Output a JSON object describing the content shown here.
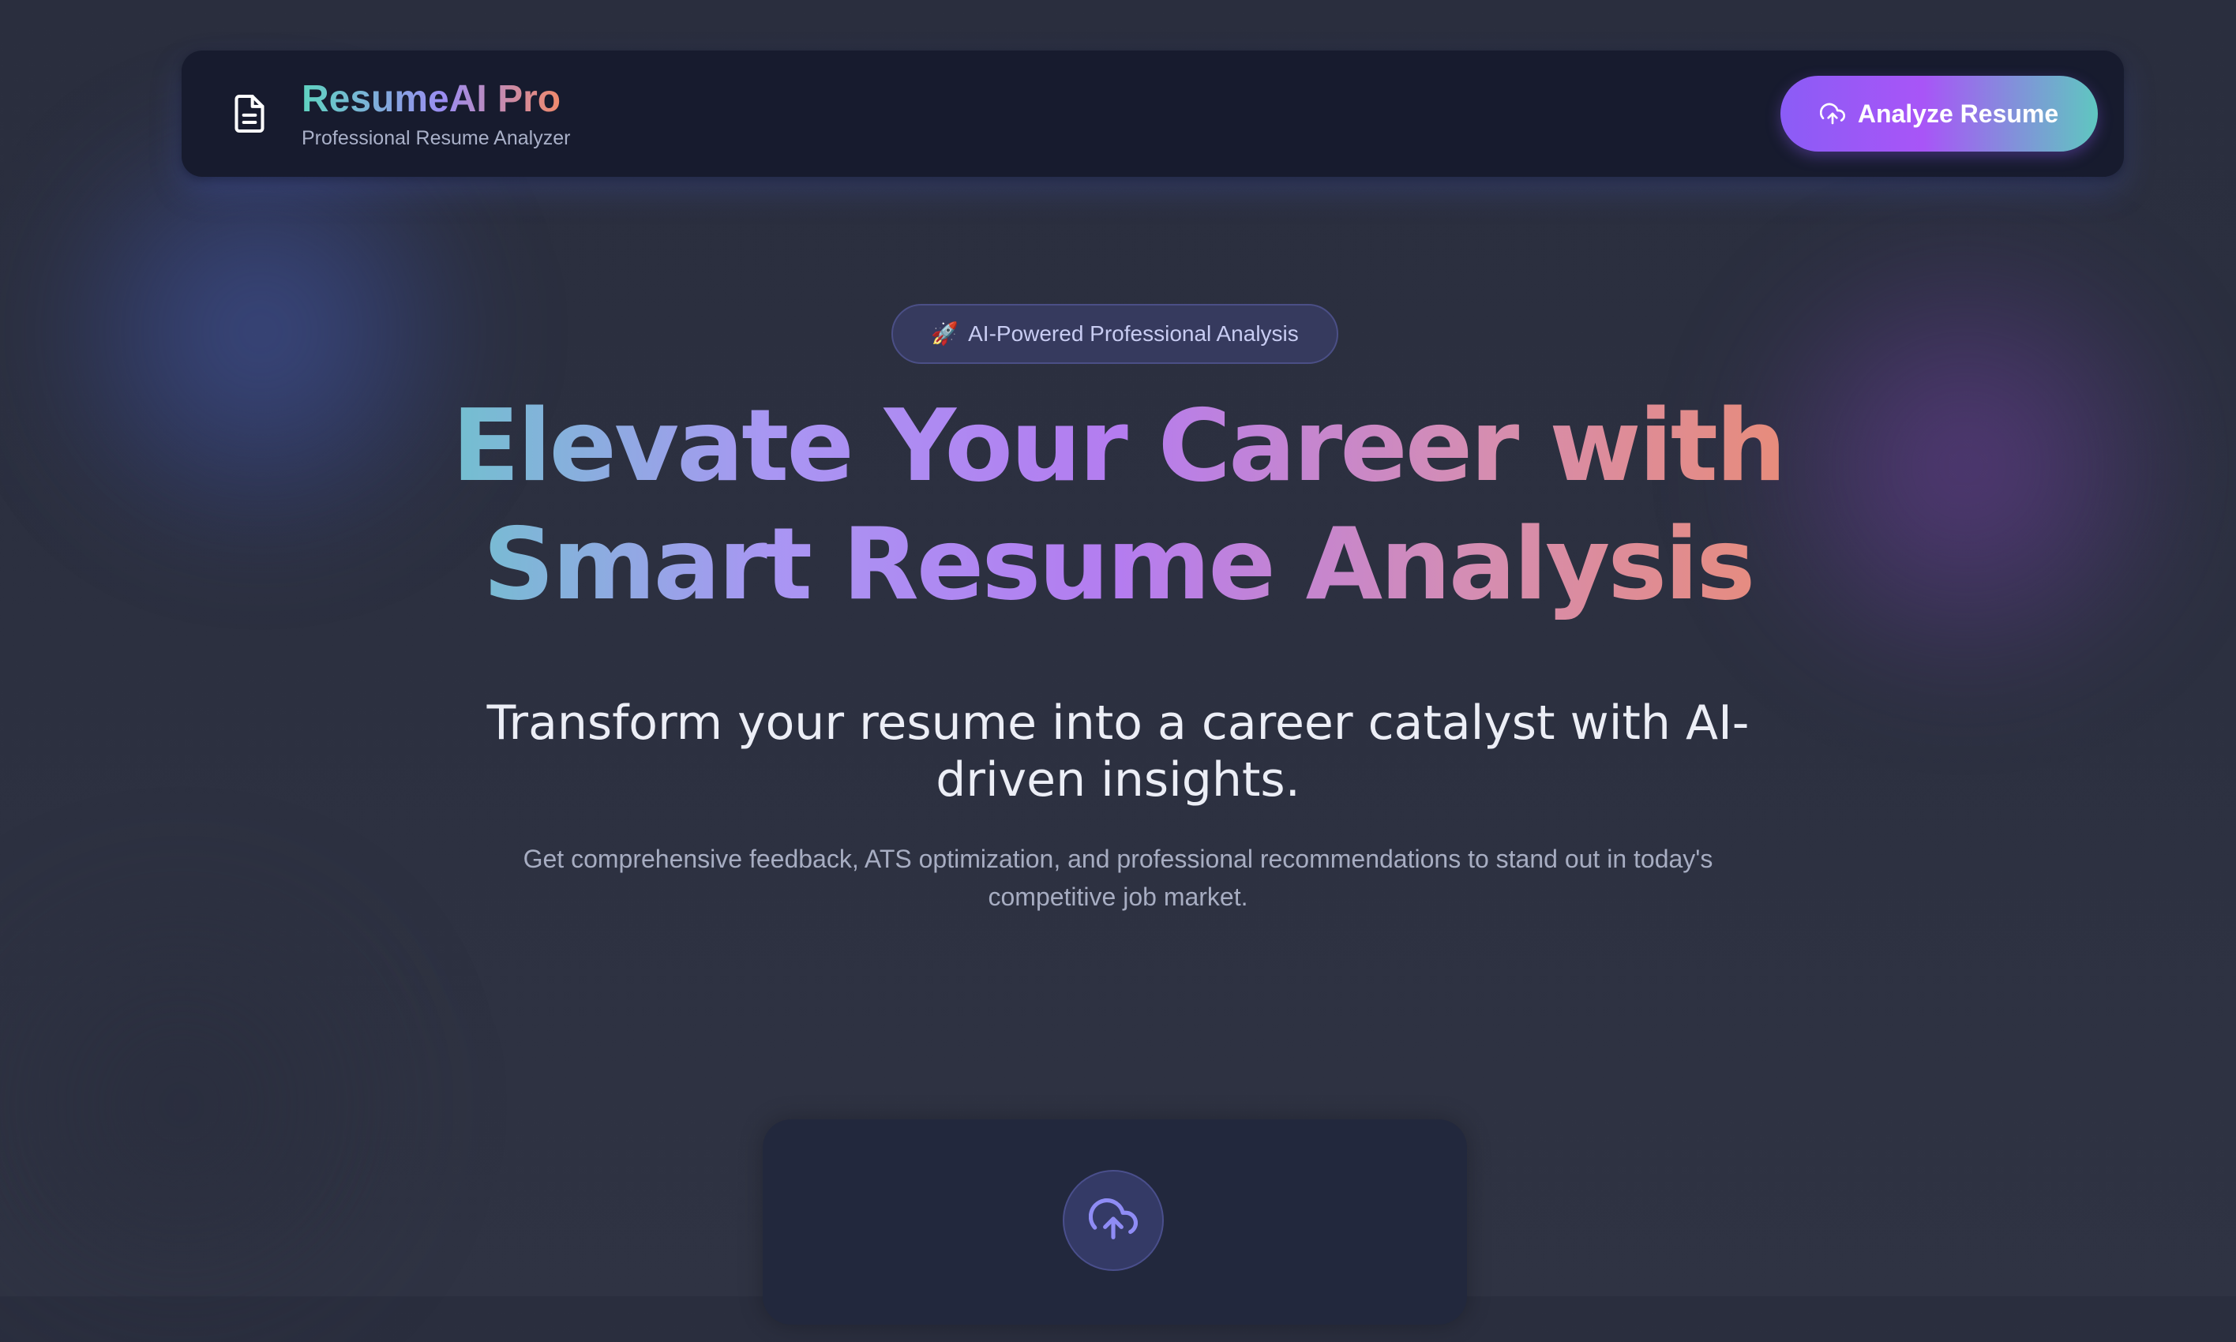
{
  "header": {
    "brand_name": "ResumeAI Pro",
    "brand_subtitle": "Professional Resume Analyzer",
    "logo_icon": "document-icon",
    "cta_label": "Analyze Resume",
    "cta_icon": "cloud-upload-icon"
  },
  "hero": {
    "badge_emoji": "🚀",
    "badge_label": "AI-Powered Professional Analysis",
    "title_line1": "Elevate Your Career with",
    "title_line2": "Smart Resume Analysis",
    "subtitle": "Transform your resume into a career catalyst with AI-driven insights.",
    "description": "Get comprehensive feedback, ATS optimization, and professional recommendations to stand out in today's competitive job market."
  },
  "upload": {
    "icon": "cloud-upload-icon"
  },
  "colors": {
    "background": "#2c3040",
    "header_bg": "#171b2e",
    "gradient_start": "#5ecfc2",
    "gradient_mid": "#b47cf0",
    "gradient_end": "#ef8b65",
    "button_start": "#8b5cf6",
    "button_end": "#5fc7c0",
    "badge_bg": "#363a5e",
    "card_bg": "#22283d"
  }
}
